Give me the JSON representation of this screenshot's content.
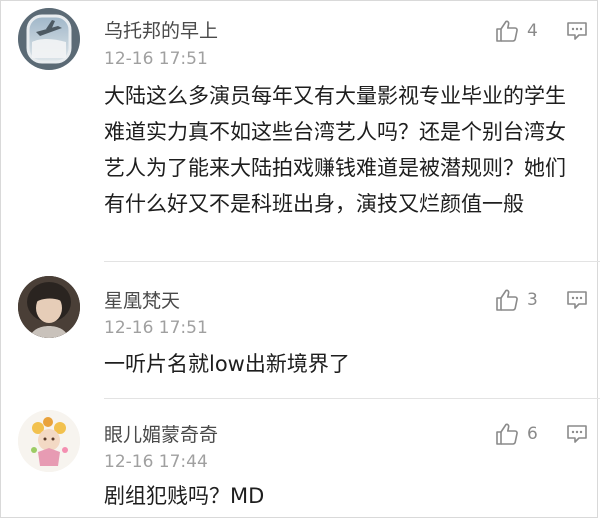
{
  "comments": [
    {
      "username": "乌托邦的早上",
      "time": "12-16 17:51",
      "likes": "4",
      "text": "大陆这么多演员每年又有大量影视专业毕业的学生难道实力真不如这些台湾艺人吗？还是个别台湾女艺人为了能来大陆拍戏赚钱难道是被潜规则？她们有什么好又不是科班出身，演技又烂颜值一般",
      "avatar": "airplane-window-avatar"
    },
    {
      "username": "星凰梵天",
      "time": "12-16 17:51",
      "likes": "3",
      "text": "一听片名就low出新境界了",
      "avatar": "person-photo-avatar"
    },
    {
      "username": "眼儿媚蒙奇奇",
      "time": "12-16 17:44",
      "likes": "6",
      "text": "剧组犯贱吗？MD",
      "avatar": "cartoon-doll-avatar"
    }
  ],
  "icons": {
    "like": "thumbs-up-icon",
    "reply": "comment-bubble-icon"
  },
  "colors": {
    "username": "#4a4a4a",
    "timestamp": "#a0a0a0",
    "text": "#1e1e1e",
    "icon": "#8a8a8a",
    "divider": "#e3e3e3"
  }
}
